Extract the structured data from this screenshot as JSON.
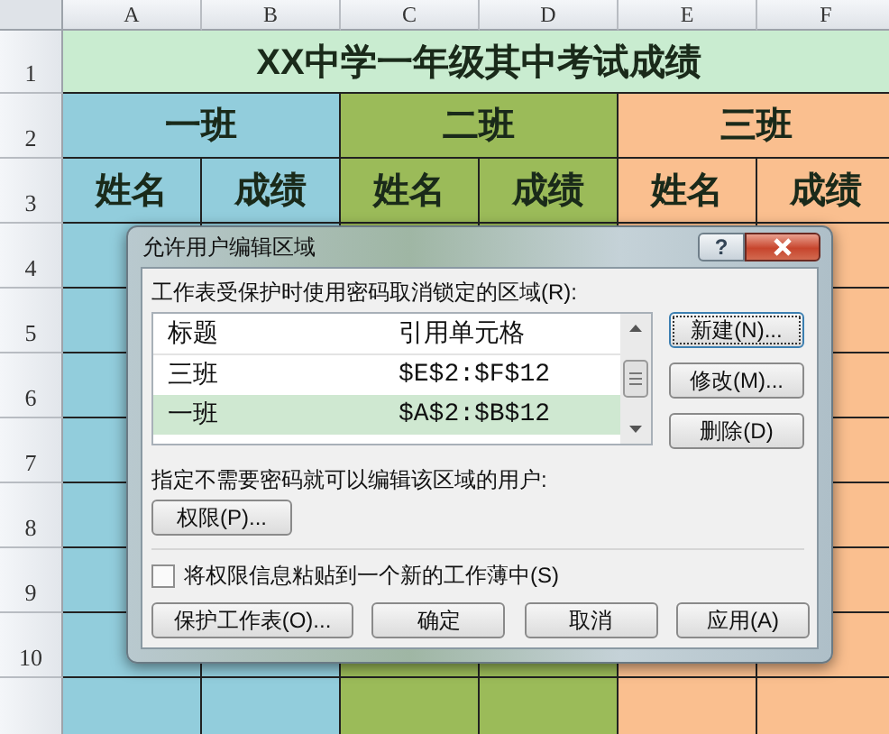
{
  "sheet": {
    "columns": [
      "A",
      "B",
      "C",
      "D",
      "E",
      "F"
    ],
    "row_numbers": [
      "1",
      "2",
      "3",
      "4",
      "5",
      "6",
      "7",
      "8",
      "9",
      "10"
    ],
    "title": "XX中学一年级其中考试成绩",
    "classes": [
      {
        "name": "一班",
        "color": "#92cddc",
        "fields": [
          "姓名",
          "成绩"
        ]
      },
      {
        "name": "二班",
        "color": "#9bbb59",
        "fields": [
          "姓名",
          "成绩"
        ]
      },
      {
        "name": "三班",
        "color": "#fabf8f",
        "fields": [
          "姓名",
          "成绩"
        ]
      }
    ]
  },
  "dialog": {
    "title": "允许用户编辑区域",
    "help_button": "?",
    "ranges_label": "工作表受保护时使用密码取消锁定的区域(R):",
    "list_columns": [
      "标题",
      "引用单元格"
    ],
    "ranges": [
      {
        "title": "三班",
        "ref": "$E$2:$F$12",
        "selected": false
      },
      {
        "title": "一班",
        "ref": "$A$2:$B$12",
        "selected": true
      }
    ],
    "side_buttons": [
      "新建(N)...",
      "修改(M)...",
      "删除(D)"
    ],
    "users_label": "指定不需要密码就可以编辑该区域的用户:",
    "permissions_button": "权限(P)...",
    "paste_option": {
      "label": "将权限信息粘贴到一个新的工作薄中(S)",
      "checked": false
    },
    "bottom_buttons": [
      "保护工作表(O)...",
      "确定",
      "取消",
      "应用(A)"
    ]
  }
}
